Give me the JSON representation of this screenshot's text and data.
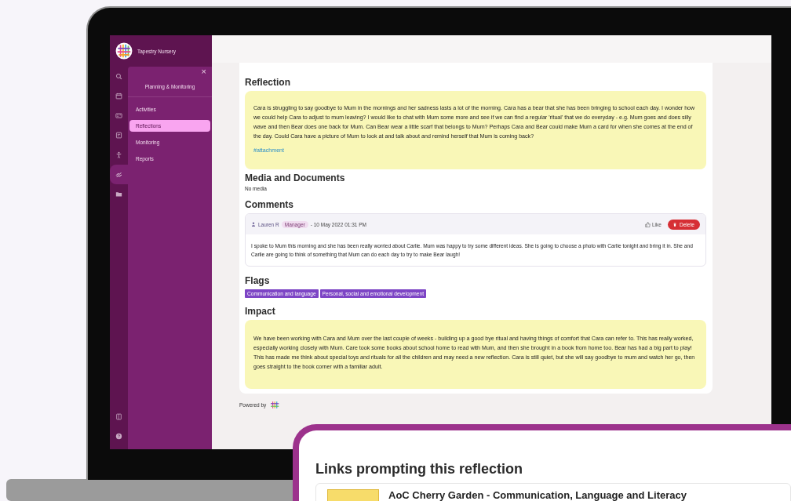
{
  "app": {
    "name": "Tapestry Nursery"
  },
  "rail": [
    {
      "kind": "search",
      "selected": false
    },
    {
      "kind": "calendar",
      "selected": false
    },
    {
      "kind": "card",
      "selected": false
    },
    {
      "kind": "document",
      "selected": false
    },
    {
      "kind": "person",
      "selected": false
    },
    {
      "kind": "hands",
      "selected": true
    },
    {
      "kind": "folder",
      "selected": false
    }
  ],
  "rail_bottom": [
    {
      "kind": "book"
    },
    {
      "kind": "help"
    }
  ],
  "submenu": {
    "close": "×",
    "title": "Planning & Monitoring",
    "items": [
      {
        "label": "Activities",
        "selected": false
      },
      {
        "label": "Reflections",
        "selected": true
      },
      {
        "label": "Monitoring",
        "selected": false
      },
      {
        "label": "Reports",
        "selected": false
      }
    ]
  },
  "reflection": {
    "heading": "Reflection",
    "text": "Cara is struggling to say goodbye to Mum in the mornings and her sadness lasts a lot of the morning. Cara has a bear that she has been bringing to school each day. I wonder how we could help Cara to adjust to mum leaving? I would like to chat with Mum some more and see if we can find a regular 'ritual' that we do everyday - e.g. Mum goes and does silly wave and then Bear does one back for Mum. Can Bear wear a little scarf that belongs to Mum? Perhaps Cara and Bear could make Mum a card for when she comes at the end of the day. Could Cara have a picture of Mum to look at and talk about and remind herself that Mum is coming back?",
    "tag": "#attachment"
  },
  "media": {
    "heading": "Media and Documents",
    "empty": "No media"
  },
  "comments": {
    "heading": "Comments",
    "items": [
      {
        "author": "Lauren R",
        "role": "Manager",
        "date": "- 10 May 2022 01:31 PM",
        "like": "Like",
        "delete": "Delete",
        "text": "I spoke to Mum this morning and she has been really worried about Carlie. Mum was happy to try some different ideas. She is going to choose a photo with Carlie tonight and bring it in. She and Carlie are going to think of something that Mum can do each day to try to make Bear laugh!"
      }
    ]
  },
  "flags": {
    "heading": "Flags",
    "items": [
      "Communication and language",
      "Personal, social and emotional development"
    ]
  },
  "impact": {
    "heading": "Impact",
    "text": "We have been working with Cara and Mum over the last couple of weeks - building up a good bye ritual and having things of comfort that Cara can refer to. This has really worked, especially working closely with Mum. Care took some books about school home to read with Mum, and then she brought in a book from home too. Bear has had a big part to play! This has made me think about special toys and rituals for all the children and may need a new reflection. Cara is still quiet, but she will say goodbye to mum and watch her go, then goes straight to the book corner with a familiar adult."
  },
  "footer": {
    "powered_by": "Powered by"
  },
  "links_panel": {
    "heading": "Links prompting this reflection",
    "items": [
      {
        "title": "AoC Cherry Garden - Communication, Language and Literacy"
      }
    ]
  }
}
